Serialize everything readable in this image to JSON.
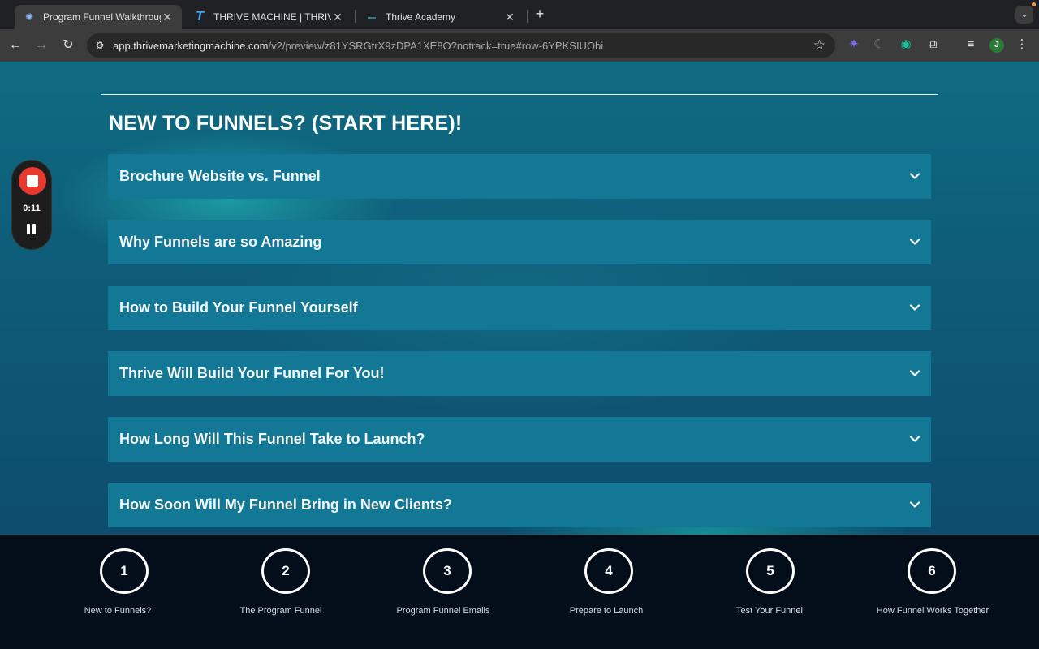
{
  "browser": {
    "tabs": [
      {
        "title": "Program Funnel Walkthrough",
        "favicon": "loom-icon",
        "active": true
      },
      {
        "title": "THRIVE MACHINE | THRIVE A",
        "favicon": "thrive-t-icon",
        "active": false
      },
      {
        "title": "Thrive Academy",
        "favicon": "page-icon",
        "active": false
      }
    ],
    "url_host": "app.thrivemarketingmachine.com",
    "url_rest": "/v2/preview/z81YSRGtrX9zDPA1XE8O?notrack=true#row-6YPKSIUObi",
    "profile_initial": "J"
  },
  "recorder": {
    "time": "0:11"
  },
  "main": {
    "heading": "NEW TO FUNNELS? (START HERE)!",
    "accordion": [
      {
        "label": "Brochure Website vs. Funnel"
      },
      {
        "label": "Why Funnels are so Amazing"
      },
      {
        "label": "How to Build Your Funnel Yourself"
      },
      {
        "label": "Thrive Will Build Your Funnel For You!"
      },
      {
        "label": "How Long Will This Funnel Take to Launch?"
      },
      {
        "label": "How Soon Will My Funnel Bring in New Clients?"
      }
    ]
  },
  "steps": [
    {
      "number": "1",
      "label": "New to Funnels?"
    },
    {
      "number": "2",
      "label": "The Program Funnel"
    },
    {
      "number": "3",
      "label": "Program Funnel Emails"
    },
    {
      "number": "4",
      "label": "Prepare to Launch"
    },
    {
      "number": "5",
      "label": "Test Your Funnel"
    },
    {
      "number": "6",
      "label": "How Funnel Works Together"
    }
  ],
  "colors": {
    "accordion_bg": "#137895",
    "page_bg": "#0e5d79",
    "steps_bg": "#040d1a",
    "record_red": "#e8392f"
  }
}
